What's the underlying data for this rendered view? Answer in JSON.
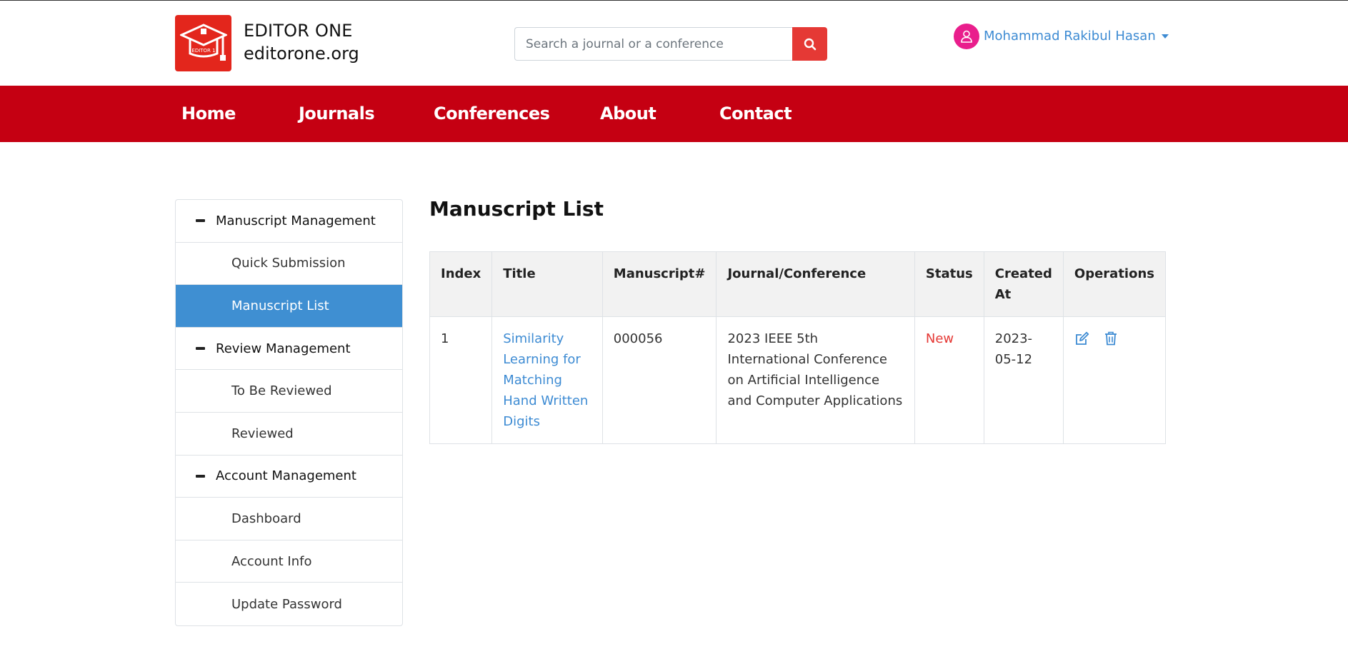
{
  "brand": {
    "name": "EDITOR ONE",
    "domain": "editorone.org",
    "logo_text": "EDITOR 1",
    "logo_color": "#e3261c"
  },
  "search": {
    "placeholder": "Search a journal or a conference",
    "button_icon": "search-icon"
  },
  "user": {
    "name": "Mohammad Rakibul Hasan",
    "avatar_icon": "user-icon"
  },
  "nav": {
    "items": [
      {
        "label": "Home"
      },
      {
        "label": "Journals"
      },
      {
        "label": "Conferences"
      },
      {
        "label": "About"
      },
      {
        "label": "Contact"
      }
    ],
    "color": "#c50012"
  },
  "sidebar": {
    "groups": [
      {
        "label": "Manuscript Management",
        "items": [
          "Quick Submission",
          "Manuscript List"
        ]
      },
      {
        "label": "Review Management",
        "items": [
          "To Be Reviewed",
          "Reviewed"
        ]
      },
      {
        "label": "Account Management",
        "items": [
          "Dashboard",
          "Account Info",
          "Update Password"
        ]
      }
    ],
    "active_item": "Manuscript List",
    "active_color": "#3f8fd2"
  },
  "main": {
    "title": "Manuscript List",
    "table": {
      "headers": [
        "Index",
        "Title",
        "Manuscript#",
        "Journal/Conference",
        "Status",
        "Created At",
        "Operations"
      ],
      "rows": [
        {
          "index": "1",
          "title": "Similarity Learning for Matching Hand Written Digits",
          "manuscript": "000056",
          "journal": "2023 IEEE 5th International Conference on Artificial Intelligence and Computer Applications",
          "status": "New",
          "created_at": "2023-05-12",
          "operations": [
            "edit-icon",
            "delete-icon"
          ]
        }
      ]
    }
  }
}
